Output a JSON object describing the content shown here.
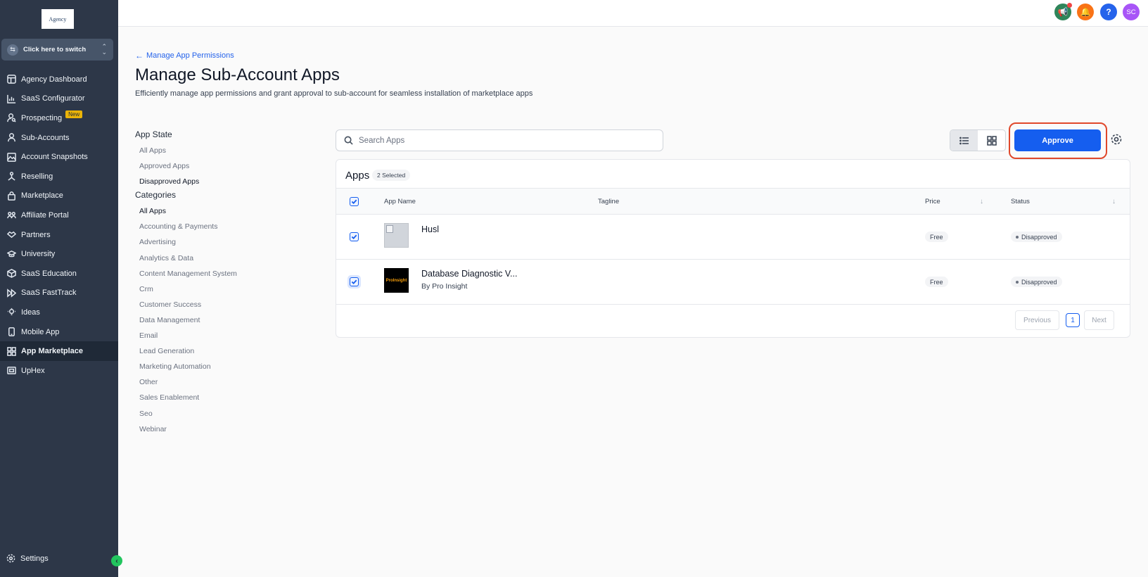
{
  "logo_text": "Agency",
  "switcher": {
    "label": "Click here to switch"
  },
  "nav": [
    {
      "label": "Agency Dashboard",
      "icon": "dashboard-icon"
    },
    {
      "label": "SaaS Configurator",
      "icon": "chart-icon"
    },
    {
      "label": "Prospecting",
      "icon": "users-search-icon",
      "badge": "New"
    },
    {
      "label": "Sub-Accounts",
      "icon": "user-icon"
    },
    {
      "label": "Account Snapshots",
      "icon": "snapshot-icon"
    },
    {
      "label": "Reselling",
      "icon": "reselling-icon"
    },
    {
      "label": "Marketplace",
      "icon": "bag-icon"
    },
    {
      "label": "Affiliate Portal",
      "icon": "affiliate-icon"
    },
    {
      "label": "Partners",
      "icon": "handshake-icon"
    },
    {
      "label": "University",
      "icon": "graduation-cap-icon"
    },
    {
      "label": "SaaS Education",
      "icon": "cube-icon"
    },
    {
      "label": "SaaS FastTrack",
      "icon": "fast-forward-icon"
    },
    {
      "label": "Ideas",
      "icon": "lightbulb-icon"
    },
    {
      "label": "Mobile App",
      "icon": "mobile-icon"
    },
    {
      "label": "App Marketplace",
      "icon": "grid-icon",
      "active": true
    },
    {
      "label": "UpHex",
      "icon": "uphex-icon"
    }
  ],
  "settings_label": "Settings",
  "topbar": {
    "avatar_initials": "SC",
    "help_label": "?"
  },
  "back_link": "Manage App Permissions",
  "page_title": "Manage Sub-Account Apps",
  "page_subtitle": "Efficiently manage app permissions and grant approval to sub-account for seamless installation of marketplace apps",
  "filters": {
    "app_state_title": "App State",
    "app_state": [
      "All Apps",
      "Approved Apps",
      "Disapproved Apps"
    ],
    "categories_title": "Categories",
    "categories": [
      "All Apps",
      "Accounting & Payments",
      "Advertising",
      "Analytics & Data",
      "Content Management System",
      "Crm",
      "Customer Success",
      "Data Management",
      "Email",
      "Lead Generation",
      "Marketing Automation",
      "Other",
      "Sales Enablement",
      "Seo",
      "Webinar"
    ]
  },
  "search": {
    "placeholder": "Search Apps"
  },
  "approve_label": "Approve",
  "apps_card": {
    "title": "Apps",
    "selected_badge": "2 Selected",
    "columns": {
      "app_name": "App Name",
      "tagline": "Tagline",
      "price": "Price",
      "status": "Status"
    },
    "rows": [
      {
        "name": "Husl",
        "by": "",
        "price": "Free",
        "status": "Disapproved",
        "checked": true
      },
      {
        "name": "Database Diagnostic V...",
        "by": "By Pro Insight",
        "price": "Free",
        "status": "Disapproved",
        "checked": true,
        "logo_text": "ProInsight"
      }
    ]
  },
  "pagination": {
    "previous": "Previous",
    "current": "1",
    "next": "Next"
  },
  "colors": {
    "accent": "#155eef",
    "sidebar": "#2d3748",
    "highlight": "#e0482b"
  }
}
